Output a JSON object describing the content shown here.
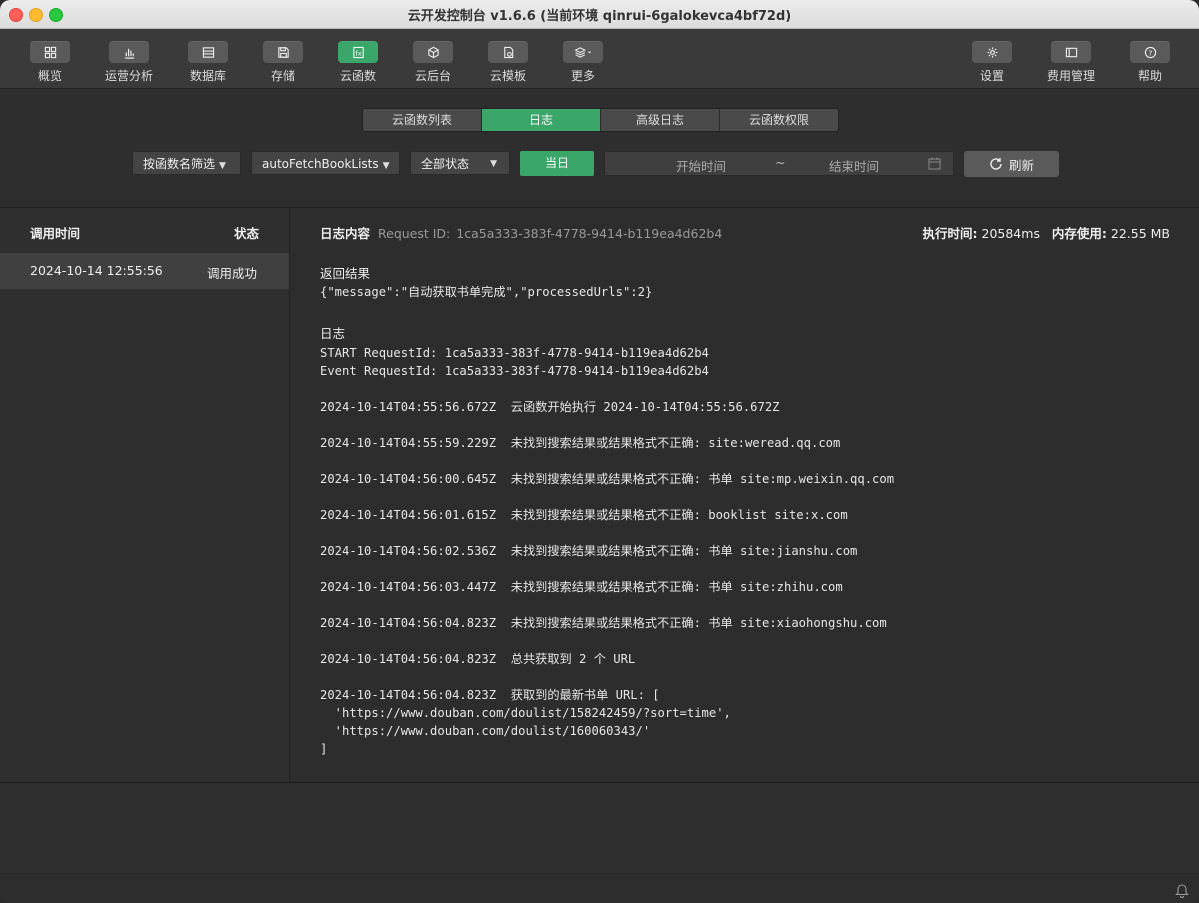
{
  "window": {
    "title": "云开发控制台 v1.6.6 (当前环境 qinrui-6galokevca4bf72d)"
  },
  "toolbar": {
    "items": [
      {
        "label": "概览",
        "icon": "grid-icon"
      },
      {
        "label": "运营分析",
        "icon": "bar-chart-icon"
      },
      {
        "label": "数据库",
        "icon": "database-icon"
      },
      {
        "label": "存储",
        "icon": "save-icon"
      },
      {
        "label": "云函数",
        "icon": "function-icon",
        "active": true
      },
      {
        "label": "云后台",
        "icon": "cube-icon"
      },
      {
        "label": "云模板",
        "icon": "template-icon"
      },
      {
        "label": "更多",
        "icon": "layers-icon"
      },
      {
        "label": "设置",
        "icon": "gear-icon"
      },
      {
        "label": "费用管理",
        "icon": "billing-icon"
      },
      {
        "label": "帮助",
        "icon": "help-icon"
      }
    ]
  },
  "tabs": [
    {
      "label": "云函数列表"
    },
    {
      "label": "日志",
      "active": true
    },
    {
      "label": "高级日志"
    },
    {
      "label": "云函数权限"
    }
  ],
  "filters": {
    "by_function": "按函数名筛选",
    "function_name": "autoFetchBookLists",
    "status": "全部状态",
    "today": "当日",
    "start_placeholder": "开始时间",
    "range_sep": "~",
    "end_placeholder": "结束时间",
    "refresh": "刷新"
  },
  "call_list": {
    "col_time": "调用时间",
    "col_status": "状态",
    "rows": [
      {
        "time": "2024-10-14 12:55:56",
        "status": "调用成功"
      }
    ]
  },
  "log": {
    "title": "日志内容",
    "request_label": "Request ID:",
    "request_id": "1ca5a333-383f-4778-9414-b119ea4d62b4",
    "exec_label": "执行时间:",
    "exec_value": "20584ms",
    "mem_label": "内存使用:",
    "mem_value": "22.55 MB",
    "result_title": "返回结果",
    "result_body": "{\"message\":\"自动获取书单完成\",\"processedUrls\":2}",
    "log_title": "日志",
    "lines": [
      "START RequestId: 1ca5a333-383f-4778-9414-b119ea4d62b4",
      "Event RequestId: 1ca5a333-383f-4778-9414-b119ea4d62b4",
      "",
      "2024-10-14T04:55:56.672Z  云函数开始执行 2024-10-14T04:55:56.672Z",
      "",
      "2024-10-14T04:55:59.229Z  未找到搜索结果或结果格式不正确: site:weread.qq.com",
      "",
      "2024-10-14T04:56:00.645Z  未找到搜索结果或结果格式不正确: 书单 site:mp.weixin.qq.com",
      "",
      "2024-10-14T04:56:01.615Z  未找到搜索结果或结果格式不正确: booklist site:x.com",
      "",
      "2024-10-14T04:56:02.536Z  未找到搜索结果或结果格式不正确: 书单 site:jianshu.com",
      "",
      "2024-10-14T04:56:03.447Z  未找到搜索结果或结果格式不正确: 书单 site:zhihu.com",
      "",
      "2024-10-14T04:56:04.823Z  未找到搜索结果或结果格式不正确: 书单 site:xiaohongshu.com",
      "",
      "2024-10-14T04:56:04.823Z  总共获取到 2 个 URL",
      "",
      "2024-10-14T04:56:04.823Z  获取到的最新书单 URL: [",
      "  'https://www.douban.com/doulist/158242459/?sort=time',",
      "  'https://www.douban.com/doulist/160060343/'",
      "]"
    ]
  }
}
